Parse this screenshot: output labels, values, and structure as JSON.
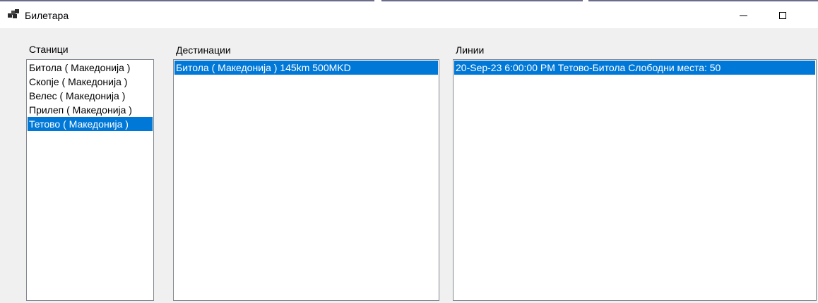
{
  "window": {
    "title": "Билетара",
    "minimize_icon": "minimize-icon",
    "maximize_icon": "maximize-icon",
    "app_icon": "app-windows-icon"
  },
  "colors": {
    "background": "#f0f0f0",
    "titlebar": "#ffffff",
    "selection": "#0078d7",
    "selection_text": "#ffffff",
    "listbox_border": "#828790"
  },
  "stations": {
    "label": "Станици",
    "items": [
      "Битола ( Македонија )",
      "Скопје ( Македонија )",
      "Велес ( Македонија )",
      "Прилеп ( Македонија )",
      "Тетово ( Македонија )"
    ],
    "selected_index": 4
  },
  "destinations": {
    "label": "Дестинации",
    "items": [
      "Битола ( Македонија ) 145km 500MKD"
    ],
    "selected_index": 0
  },
  "lines": {
    "label": "Линии",
    "items": [
      "20-Sep-23 6:00:00 PM Тетово-Битола Слободни места: 50"
    ],
    "selected_index": 0
  }
}
